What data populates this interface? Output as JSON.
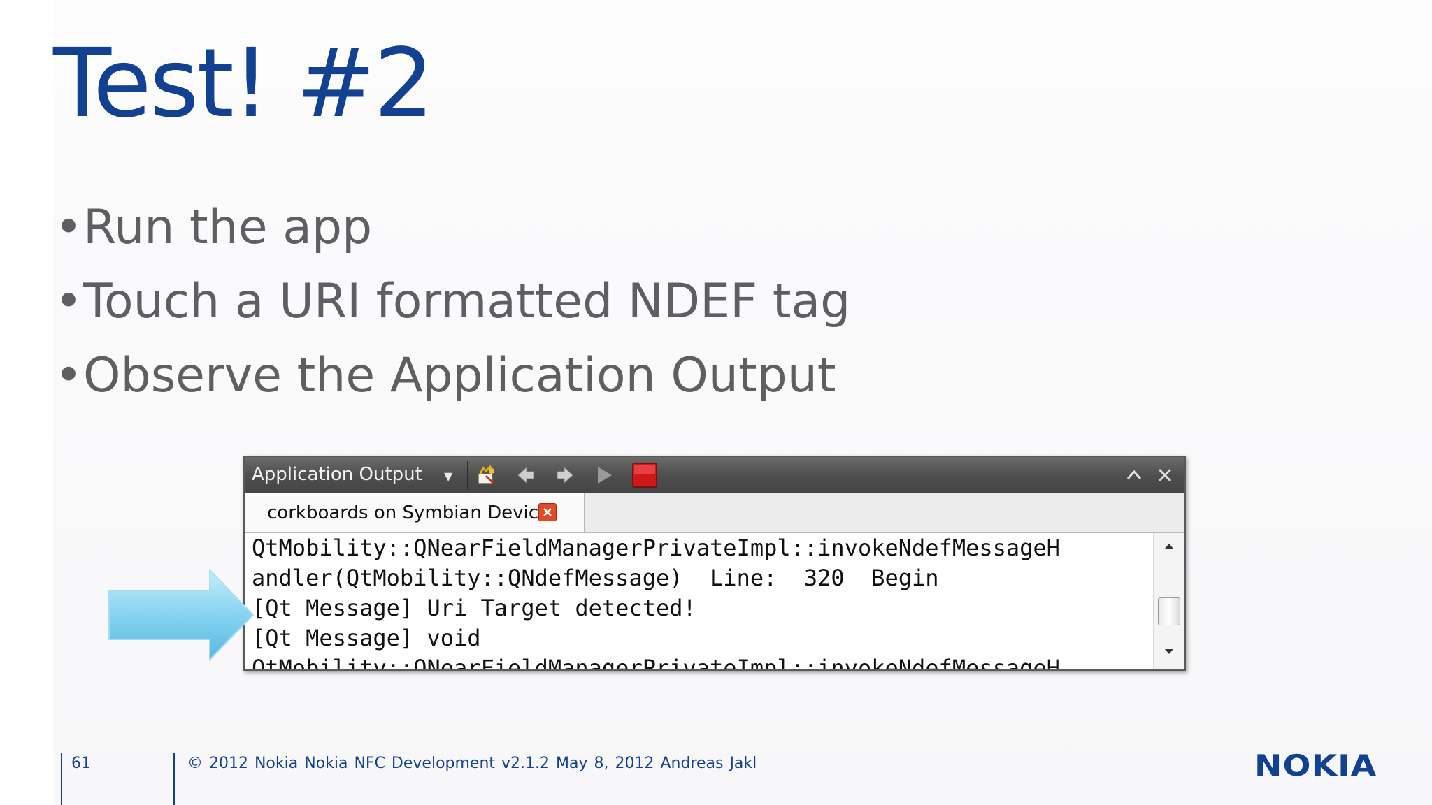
{
  "slide": {
    "title": "Test! #2",
    "bullets": [
      "Run the app",
      "Touch a URI formatted NDEF tag",
      "Observe the Application Output"
    ],
    "bullet_symbol": "•"
  },
  "panel": {
    "title": "Application Output",
    "toolbar_icons": [
      "clear-icon",
      "previous-icon",
      "next-icon",
      "run-icon",
      "stop-icon",
      "maximize-icon",
      "close-icon"
    ],
    "tab_label": "corkboards on Symbian Device",
    "output_lines": [
      "QtMobility::QNearFieldManagerPrivateImpl::invokeNdefMessageH",
      "andler(QtMobility::QNdefMessage)  Line:  320  Begin",
      "[Qt Message] Uri Target detected!",
      "[Qt Message] void",
      "QtMobility::QNearFieldManagerPrivateImpl::invokeNdefMessageH"
    ]
  },
  "footer": {
    "page_number": "61",
    "info": "© 2012 Nokia   Nokia NFC Development   v2.1.2   May 8, 2012   Andreas Jakl",
    "logo": "NOKIA"
  },
  "colors": {
    "brand_blue": "#124191",
    "bullet_gray": "#5f5f62",
    "stop_red": "#d01818",
    "arrow_cyan": "#7fd0ee"
  }
}
